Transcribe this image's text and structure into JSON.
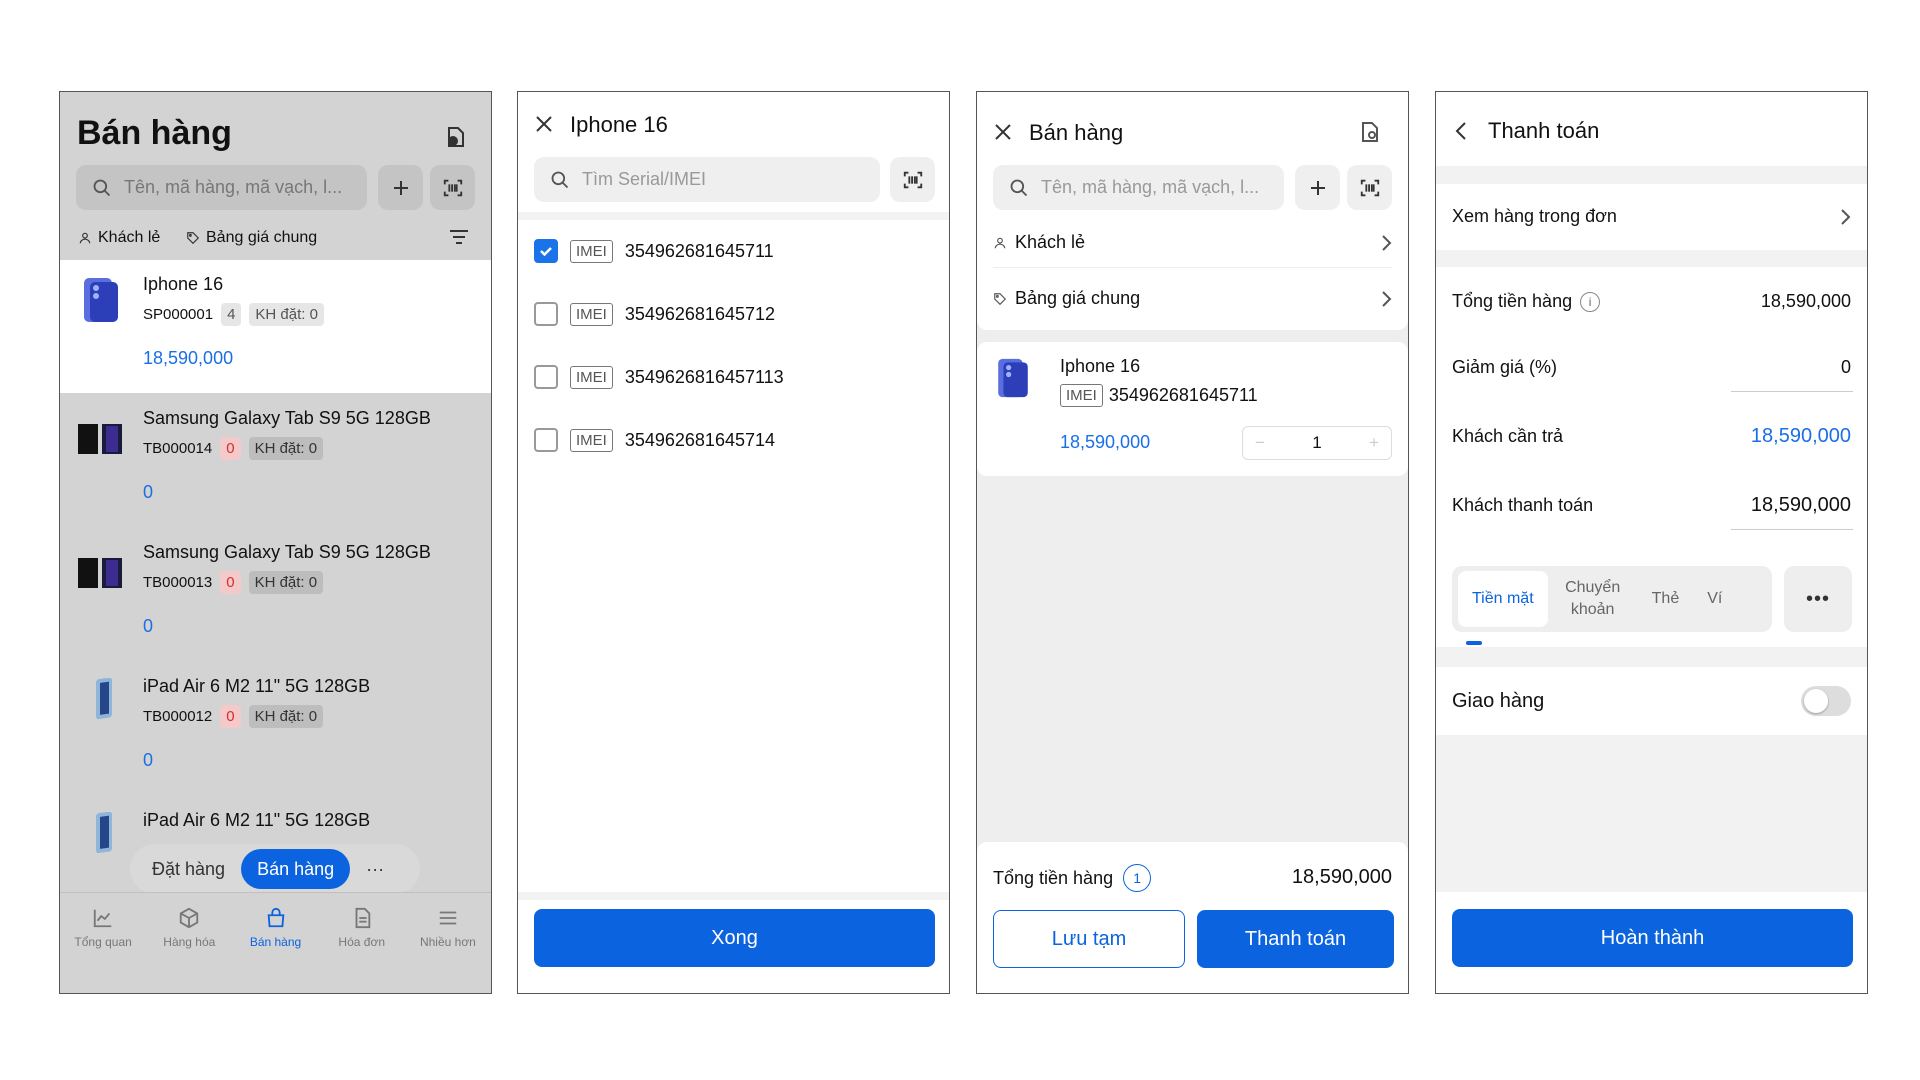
{
  "colors": {
    "accent": "#0b63e0",
    "price_blue": "#1a6fe8",
    "stock_red": "#d32f2f"
  },
  "panel1": {
    "title": "Bán hàng",
    "search_placeholder": "Tên, mã hàng, mã vạch, l...",
    "customer": "Khách lẻ",
    "pricebook": "Bảng giá chung",
    "products": [
      {
        "name": "Iphone 16",
        "code": "SP000001",
        "stock": "4",
        "ordered": "KH đặt: 0",
        "price": "18,590,000"
      },
      {
        "name": "Samsung Galaxy Tab S9 5G 128GB",
        "code": "TB000014",
        "stock": "0",
        "ordered": "KH đặt: 0",
        "price": "0"
      },
      {
        "name": "Samsung Galaxy Tab S9 5G 128GB",
        "code": "TB000013",
        "stock": "0",
        "ordered": "KH đặt: 0",
        "price": "0"
      },
      {
        "name": "iPad Air 6 M2 11\" 5G 128GB",
        "code": "TB000012",
        "stock": "0",
        "ordered": "KH đặt: 0",
        "price": "0"
      },
      {
        "name": "iPad Air 6 M2 11\" 5G 128GB"
      }
    ],
    "float_bar": {
      "order": "Đặt hàng",
      "sell": "Bán hàng",
      "more": "···"
    },
    "tabs": [
      "Tổng quan",
      "Hàng hóa",
      "Bán hàng",
      "Hóa đơn",
      "Nhiều hơn"
    ]
  },
  "panel2": {
    "title": "Iphone 16",
    "search_placeholder": "Tìm Serial/IMEI",
    "imei_tag": "IMEI",
    "imeis": [
      {
        "value": "354962681645711",
        "checked": true
      },
      {
        "value": "354962681645712",
        "checked": false
      },
      {
        "value": "3549626816457113",
        "checked": false
      },
      {
        "value": "354962681645714",
        "checked": false
      }
    ],
    "done": "Xong"
  },
  "panel3": {
    "title": "Bán hàng",
    "search_placeholder": "Tên, mã hàng, mã vạch, l...",
    "customer": "Khách lẻ",
    "pricebook": "Bảng giá chung",
    "item": {
      "name": "Iphone 16",
      "imei_tag": "IMEI",
      "imei": "354962681645711",
      "price": "18,590,000",
      "qty": "1",
      "minus": "−",
      "plus": "+"
    },
    "total_label": "Tổng tiền hàng",
    "total_count": "1",
    "total_value": "18,590,000",
    "save_draft": "Lưu tạm",
    "pay": "Thanh toán"
  },
  "panel4": {
    "title": "Thanh toán",
    "view_items": "Xem hàng trong đơn",
    "subtotal_label": "Tổng tiền hàng",
    "info_mark": "i",
    "subtotal": "18,590,000",
    "discount_label": "Giảm giá (%)",
    "discount": "0",
    "due_label": "Khách cần trả",
    "due": "18,590,000",
    "paid_label": "Khách thanh toán",
    "paid": "18,590,000",
    "methods": [
      "Tiền mặt",
      "Chuyển khoản",
      "Thẻ",
      "Ví"
    ],
    "more": "•••",
    "delivery": "Giao hàng",
    "finish": "Hoàn thành"
  }
}
